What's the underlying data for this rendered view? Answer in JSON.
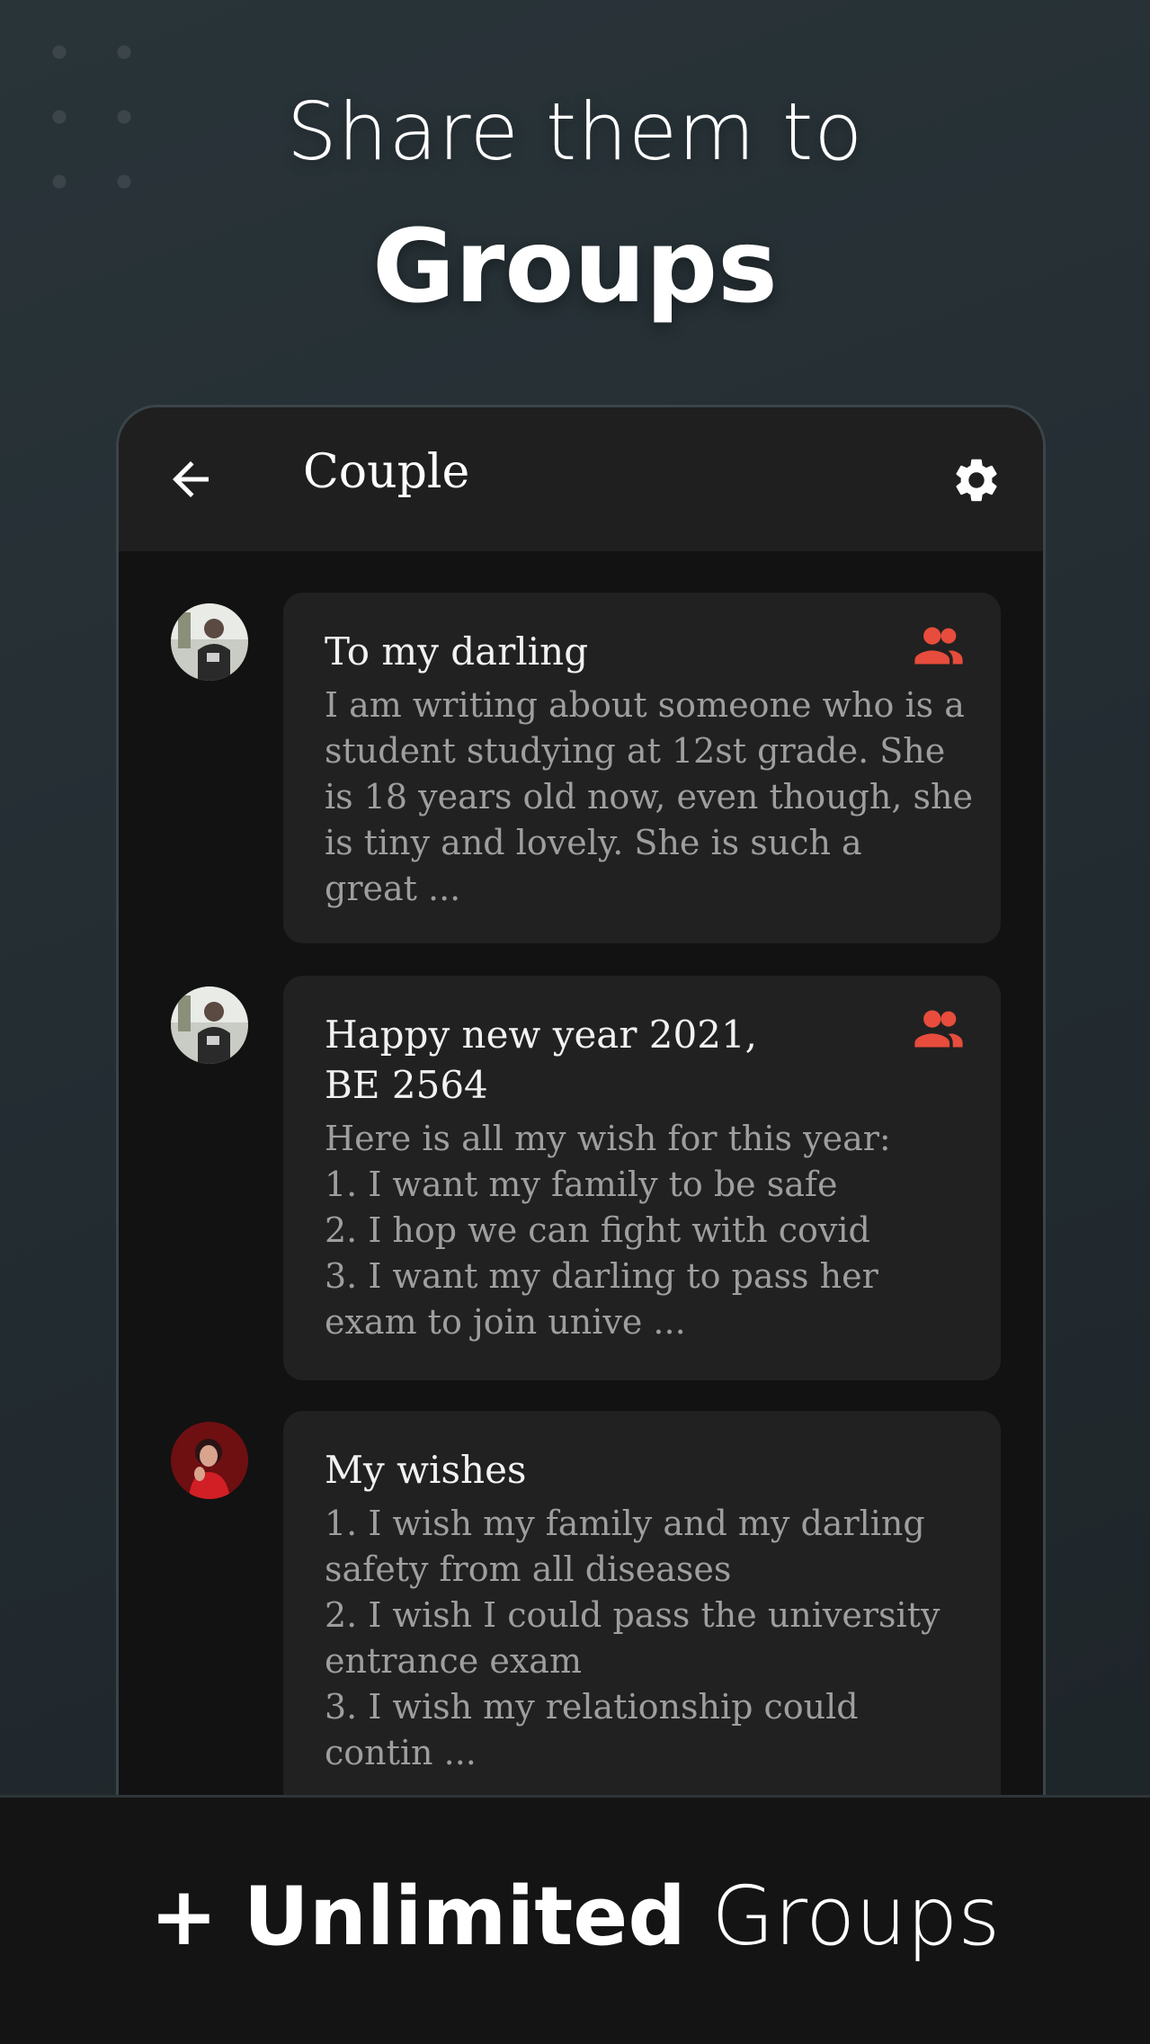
{
  "promo": {
    "headline": "Share them to",
    "headline_strong": "Groups",
    "footer_plus": "+",
    "footer_strong": "Unlimited",
    "footer_rest": "Groups"
  },
  "appbar": {
    "title": "Couple",
    "back_icon": "arrow-left-icon",
    "settings_icon": "gear-icon"
  },
  "colors": {
    "accent": "#e74c3c",
    "card_bg": "#212121",
    "screen_bg": "#121212",
    "appbar_bg": "#1f1f1f"
  },
  "posts": [
    {
      "title": "To my darling",
      "body": "I am writing about someone who is a\nstudent studying at 12st grade. She\nis 18 years old now, even though, she\nis tiny and lovely. She is such a\ngreat  ...",
      "shared_icon": "group-icon",
      "avatar": "male-user-avatar"
    },
    {
      "title": "Happy new year 2021,\nBE 2564",
      "body": "Here is all my wish for this year:\n1. I want my family to be safe\n2. I hop we can fight with covid\n3. I want my darling to pass her\nexam to join unive ...",
      "shared_icon": "group-icon",
      "avatar": "male-user-avatar"
    },
    {
      "title": "My wishes",
      "body": "1. I wish my family and my darling\nsafety from all diseases\n2. I wish I could pass the university\nentrance exam\n3. I wish my relationship could\ncontin ...",
      "shared_icon": "",
      "avatar": "female-user-avatar"
    }
  ]
}
